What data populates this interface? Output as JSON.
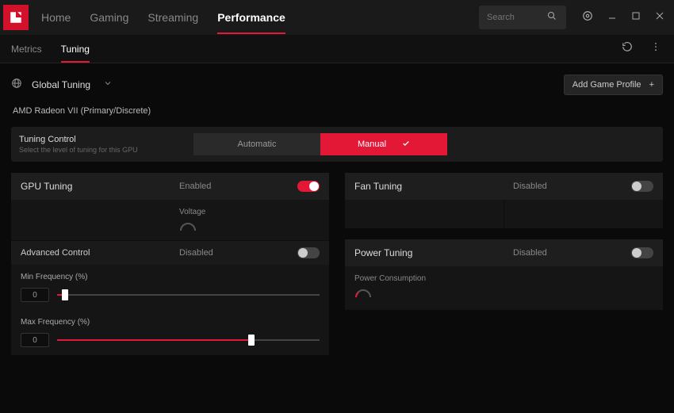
{
  "nav": {
    "home": "Home",
    "gaming": "Gaming",
    "streaming": "Streaming",
    "performance": "Performance"
  },
  "search": {
    "placeholder": "Search"
  },
  "subnav": {
    "metrics": "Metrics",
    "tuning": "Tuning"
  },
  "top": {
    "global_tuning": "Global Tuning",
    "add_game_profile": "Add Game Profile"
  },
  "gpu_name": "AMD Radeon VII (Primary/Discrete)",
  "tuning_control": {
    "title": "Tuning Control",
    "subtitle": "Select the level of tuning for this GPU",
    "automatic": "Automatic",
    "manual": "Manual"
  },
  "gpu_tuning": {
    "title": "GPU Tuning",
    "state": "Enabled",
    "voltage_label": "Voltage"
  },
  "advanced_control": {
    "title": "Advanced Control",
    "state": "Disabled"
  },
  "min_freq": {
    "label": "Min Frequency (%)",
    "value": "0",
    "percent": 3
  },
  "max_freq": {
    "label": "Max Frequency (%)",
    "value": "0",
    "percent": 74
  },
  "fan_tuning": {
    "title": "Fan Tuning",
    "state": "Disabled"
  },
  "power_tuning": {
    "title": "Power Tuning",
    "state": "Disabled",
    "power_consumption": "Power Consumption"
  }
}
